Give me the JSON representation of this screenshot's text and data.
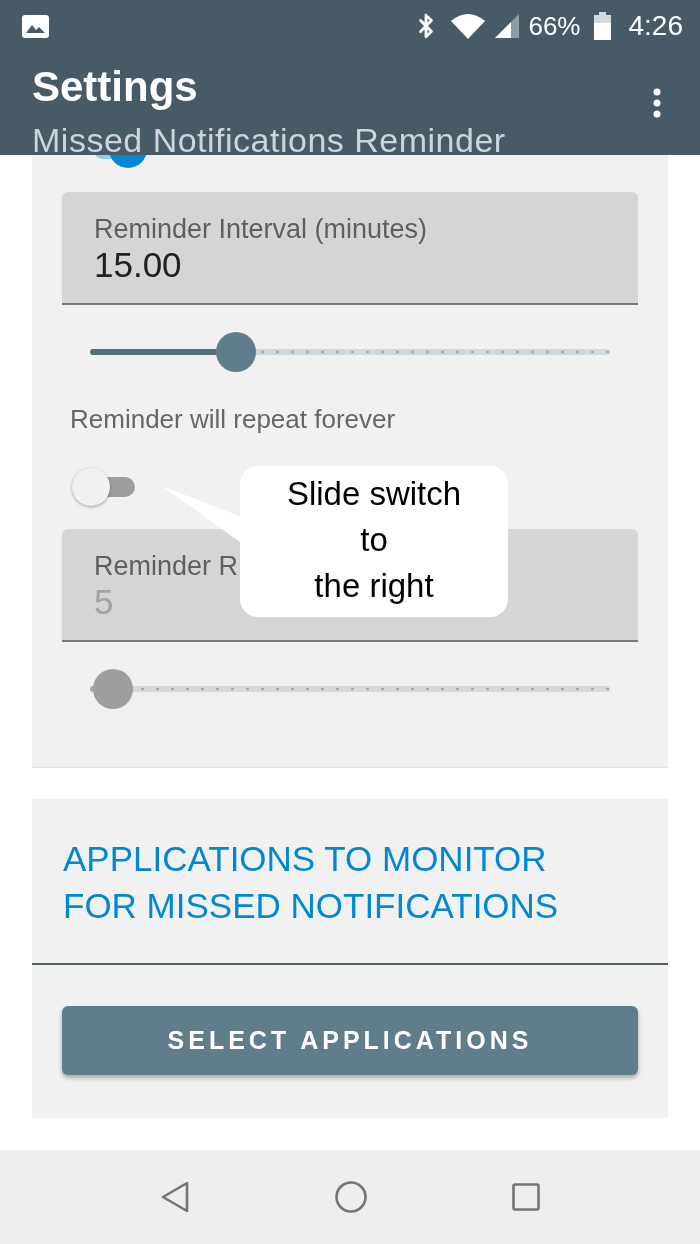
{
  "status_bar": {
    "battery": "66%",
    "time": "4:26"
  },
  "app_bar": {
    "title": "Settings",
    "subtitle": "Missed Notifications Reminder"
  },
  "top_switch": {
    "on": true
  },
  "interval_field": {
    "label": "Reminder Interval (minutes)",
    "value": "15.00",
    "disabled": false
  },
  "interval_slider": {
    "level": 0.28,
    "disabled": false
  },
  "repeat_note": "Reminder will repeat forever",
  "repeat_switch": {
    "on": false
  },
  "repeat_field": {
    "label": "Reminder R",
    "value": "5",
    "disabled": true
  },
  "repeat_slider": {
    "level": 0.045,
    "disabled": true
  },
  "callout": {
    "lines": [
      "Slide switch",
      "to",
      "the right"
    ]
  },
  "apps_section": {
    "heading": "APPLICATIONS TO MONITOR FOR MISSED NOTIFICATIONS",
    "button": "SELECT APPLICATIONS"
  }
}
